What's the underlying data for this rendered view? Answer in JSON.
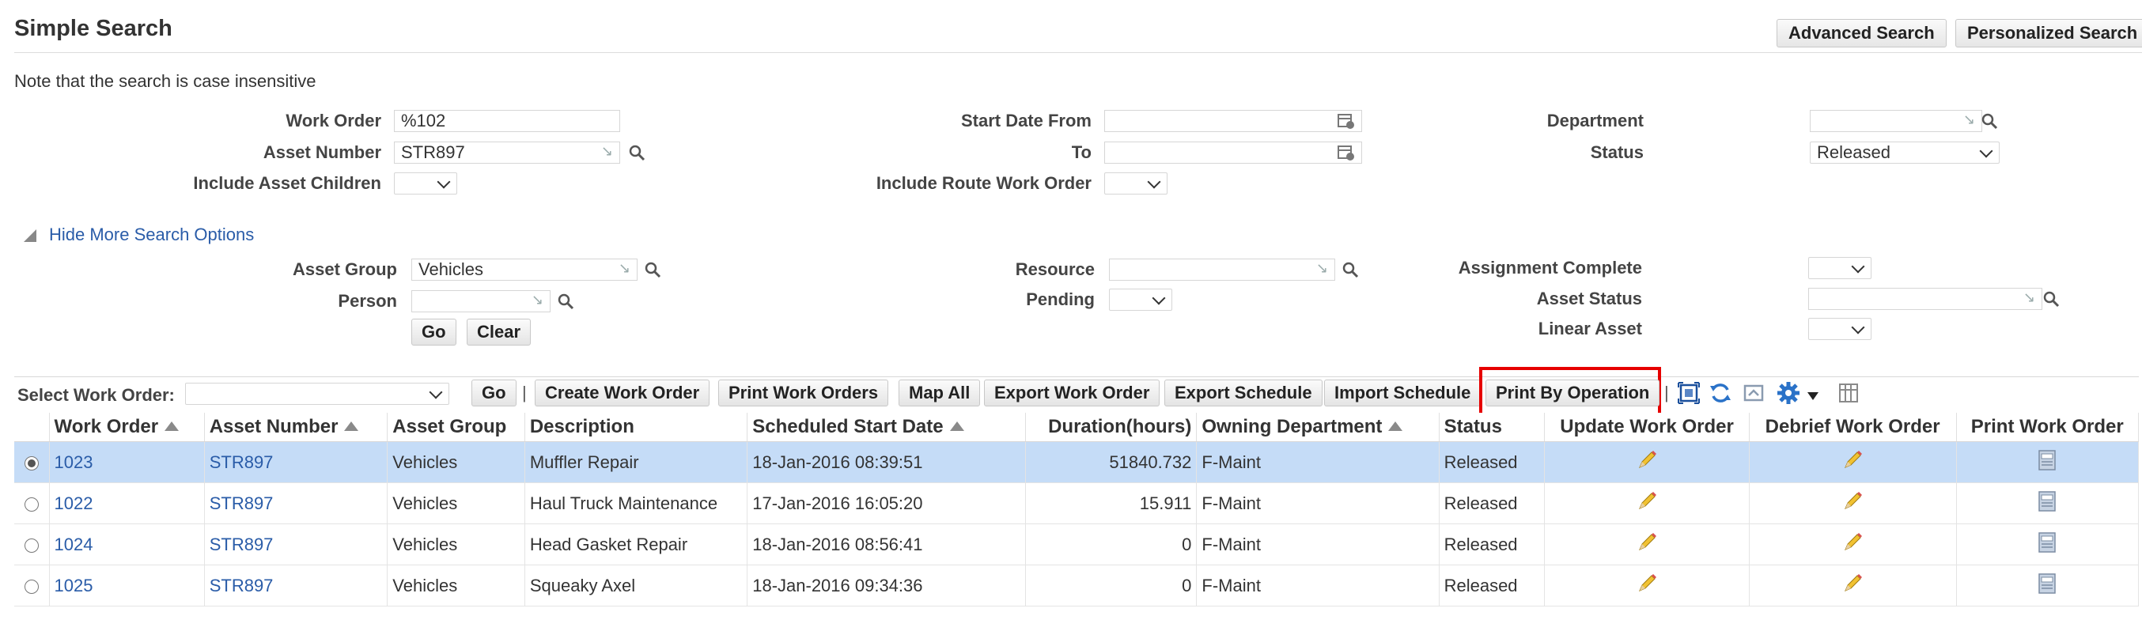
{
  "page": {
    "title": "Simple Search",
    "advanced_search": "Advanced Search",
    "personalized_search": "Personalized Search",
    "note": "Note that the search is case insensitive"
  },
  "search": {
    "work_order": {
      "label": "Work Order",
      "value": "%102"
    },
    "asset_number": {
      "label": "Asset Number",
      "value": "STR897"
    },
    "include_asset_children": {
      "label": "Include Asset Children",
      "value": ""
    },
    "start_date_from": {
      "label": "Start Date From",
      "value": ""
    },
    "to": {
      "label": "To",
      "value": ""
    },
    "include_route_work_order": {
      "label": "Include Route Work Order",
      "value": ""
    },
    "department": {
      "label": "Department",
      "value": ""
    },
    "status": {
      "label": "Status",
      "value": "Released"
    }
  },
  "more_options": {
    "toggle_label": "Hide More Search Options",
    "asset_group": {
      "label": "Asset Group",
      "value": "Vehicles"
    },
    "person": {
      "label": "Person",
      "value": ""
    },
    "resource": {
      "label": "Resource",
      "value": ""
    },
    "pending": {
      "label": "Pending",
      "value": ""
    },
    "assignment_complete": {
      "label": "Assignment Complete",
      "value": ""
    },
    "asset_status": {
      "label": "Asset Status",
      "value": ""
    },
    "linear_asset": {
      "label": "Linear Asset",
      "value": ""
    },
    "go": "Go",
    "clear": "Clear"
  },
  "toolbar": {
    "select_label": "Select Work Order:",
    "select_value": "",
    "go": "Go",
    "separator": "|",
    "buttons": [
      "Create Work Order",
      "Print Work Orders",
      "Map All",
      "Export Work Order",
      "Export Schedule",
      "Import Schedule",
      "Print By Operation"
    ],
    "highlight_color": "#e60000",
    "icons": [
      "detach-icon",
      "refresh-icon",
      "freeze-icon",
      "settings-icon",
      "columns-icon"
    ]
  },
  "table": {
    "columns": [
      "Work Order",
      "Asset Number",
      "Asset Group",
      "Description",
      "Scheduled Start Date",
      "Duration(hours)",
      "Owning Department",
      "Status",
      "Update Work Order",
      "Debrief Work Order",
      "Print Work Order"
    ],
    "rows": [
      {
        "work_order": "1023",
        "asset_number": "STR897",
        "asset_group": "Vehicles",
        "description": "Muffler Repair",
        "start": "18-Jan-2016 08:39:51",
        "duration": "51840.732",
        "dept": "F-Maint",
        "status": "Released",
        "selected": true
      },
      {
        "work_order": "1022",
        "asset_number": "STR897",
        "asset_group": "Vehicles",
        "description": "Haul Truck Maintenance",
        "start": "17-Jan-2016 16:05:20",
        "duration": "15.911",
        "dept": "F-Maint",
        "status": "Released",
        "selected": false
      },
      {
        "work_order": "1024",
        "asset_number": "STR897",
        "asset_group": "Vehicles",
        "description": "Head Gasket Repair",
        "start": "18-Jan-2016 08:56:41",
        "duration": "0",
        "dept": "F-Maint",
        "status": "Released",
        "selected": false
      },
      {
        "work_order": "1025",
        "asset_number": "STR897",
        "asset_group": "Vehicles",
        "description": "Squeaky Axel",
        "start": "18-Jan-2016 09:34:36",
        "duration": "0",
        "dept": "F-Maint",
        "status": "Released",
        "selected": false
      }
    ]
  }
}
